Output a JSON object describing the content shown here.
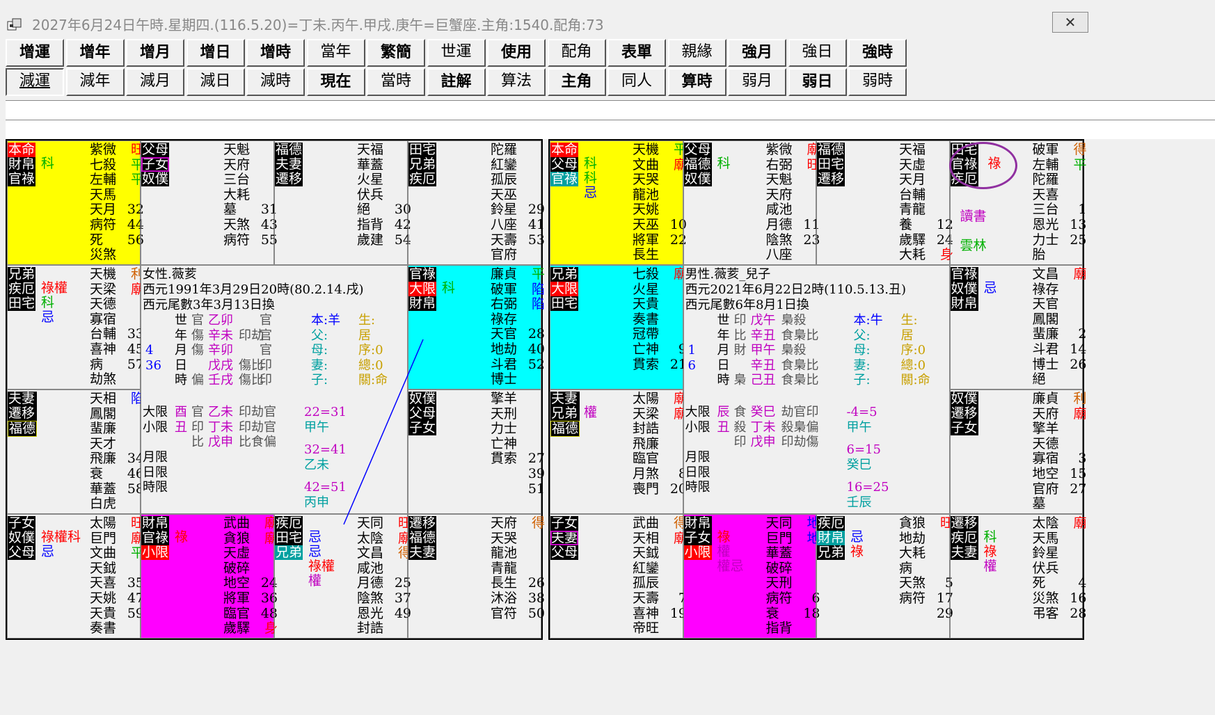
{
  "window": {
    "title": "2027年6月24日午時.星期四.(116.5.20)=丁未.丙午.甲戌.庚午=巨蟹座.主角:1540.配角:73",
    "close": "✕"
  },
  "toolbar": {
    "row1": [
      "增運",
      "增年",
      "增月",
      "增日",
      "增時",
      "當年",
      "繁簡",
      "世運",
      "使用",
      "配角",
      "表單",
      "親緣",
      "強月",
      "強日",
      "強時"
    ],
    "row2": [
      "減運",
      "減年",
      "減月",
      "減日",
      "減時",
      "現在",
      "當時",
      "註解",
      "算法",
      "主角",
      "同人",
      "算時",
      "弱月",
      "弱日",
      "弱時"
    ]
  },
  "left_chart": {
    "c00": {
      "labels": [
        "本命",
        "財帛",
        "官祿"
      ],
      "marks": [
        "科"
      ],
      "stars": [
        [
          "紫微",
          "旺"
        ],
        [
          "七殺",
          "平"
        ],
        [
          "左輔",
          "平"
        ],
        [
          "天馬",
          ""
        ],
        [
          "天月",
          "32"
        ],
        [
          "病符",
          "44"
        ],
        [
          "死",
          "56"
        ],
        [
          "災煞",
          ""
        ]
      ]
    },
    "c01": {
      "labels": [
        "父母",
        "子女",
        "奴僕"
      ],
      "stars": [
        [
          "天魁",
          ""
        ],
        [
          "天府",
          ""
        ],
        [
          "三台",
          ""
        ],
        [
          "大耗",
          ""
        ],
        [
          "墓",
          "31"
        ],
        [
          "天煞",
          "43"
        ],
        [
          "病符",
          "55"
        ]
      ]
    },
    "c02": {
      "labels": [
        "福德",
        "夫妻",
        "遷移"
      ],
      "stars": [
        [
          "天福",
          ""
        ],
        [
          "華蓋",
          ""
        ],
        [
          "火星",
          ""
        ],
        [
          "伏兵",
          ""
        ],
        [
          "絕",
          "30"
        ],
        [
          "指背",
          "42"
        ],
        [
          "歲建",
          "54"
        ]
      ]
    },
    "c03": {
      "labels": [
        "田宅",
        "兄弟",
        "疾厄"
      ],
      "stars": [
        [
          "陀羅",
          ""
        ],
        [
          "紅鑾",
          ""
        ],
        [
          "孤辰",
          ""
        ],
        [
          "天巫",
          ""
        ],
        [
          "鈴星",
          "29"
        ],
        [
          "八座",
          "41"
        ],
        [
          "天壽",
          "53"
        ],
        [
          "官府",
          ""
        ]
      ]
    },
    "c10": {
      "labels": [
        "兄弟",
        "疾厄",
        "田宅"
      ],
      "marks": [
        "祿權",
        "科",
        "忌"
      ],
      "stars": [
        [
          "天機",
          "利"
        ],
        [
          "天梁",
          "廟"
        ],
        [
          "天德",
          ""
        ],
        [
          "寡宿",
          ""
        ],
        [
          "台輔",
          "33"
        ],
        [
          "喜神",
          "45"
        ],
        [
          "病",
          "57"
        ],
        [
          "劫煞",
          ""
        ]
      ]
    },
    "c13": {
      "labels": [
        "官祿",
        "大限",
        "財帛"
      ],
      "marks": [
        "科"
      ],
      "stars": [
        [
          "廉貞",
          "平"
        ],
        [
          "破軍",
          "陷"
        ],
        [
          "右弼",
          "陷"
        ],
        [
          "祿存",
          ""
        ],
        [
          "天官",
          "28"
        ],
        [
          "地劫",
          "40"
        ],
        [
          "斗君",
          "52"
        ],
        [
          "博士",
          ""
        ]
      ]
    },
    "c20": {
      "labels": [
        "夫妻",
        "遷移",
        "福德"
      ],
      "stars": [
        [
          "天相",
          "陷"
        ],
        [
          "鳳閣",
          ""
        ],
        [
          "蜚廉",
          ""
        ],
        [
          "天才",
          ""
        ],
        [
          "飛廉",
          "34"
        ],
        [
          "衰",
          "46"
        ],
        [
          "華蓋",
          "58"
        ],
        [
          "白虎",
          ""
        ]
      ]
    },
    "c23": {
      "labels": [
        "奴僕",
        "父母",
        "子女"
      ],
      "stars": [
        [
          "擎羊",
          ""
        ],
        [
          "天刑",
          ""
        ],
        [
          "力士",
          ""
        ],
        [
          "亡神",
          ""
        ],
        [
          "貫索",
          "27"
        ],
        [
          "",
          "39"
        ],
        [
          "",
          "51"
        ]
      ]
    },
    "c30": {
      "labels": [
        "子女",
        "奴僕",
        "父母"
      ],
      "marks": [
        "祿權科",
        "忌"
      ],
      "stars": [
        [
          "太陽",
          "旺"
        ],
        [
          "巨門",
          "廟"
        ],
        [
          "文曲",
          "平"
        ],
        [
          "天鉞",
          ""
        ],
        [
          "天喜",
          "35"
        ],
        [
          "天姚",
          "47"
        ],
        [
          "天貴",
          "59"
        ],
        [
          "奏書",
          ""
        ]
      ]
    },
    "c31": {
      "labels": [
        "財帛",
        "官祿",
        "小限"
      ],
      "marks": [
        "祿"
      ],
      "stars": [
        [
          "武曲",
          "廟"
        ],
        [
          "貪狼",
          "廟"
        ],
        [
          "天虛",
          ""
        ],
        [
          "破碎",
          ""
        ],
        [
          "地空",
          "24"
        ],
        [
          "將軍",
          "36"
        ],
        [
          "臨官",
          "48"
        ],
        [
          "歲驛",
          "身"
        ]
      ]
    },
    "c32": {
      "labels": [
        "疾厄",
        "田宅",
        "兄弟"
      ],
      "marks": [
        "忌",
        "忌",
        "祿權",
        "權"
      ],
      "stars": [
        [
          "天同",
          "旺"
        ],
        [
          "太陰",
          "廟"
        ],
        [
          "文昌",
          "得"
        ],
        [
          "咸池",
          ""
        ],
        [
          "月德",
          "25"
        ],
        [
          "陰煞",
          "37"
        ],
        [
          "恩光",
          "49"
        ],
        [
          "封誥",
          ""
        ]
      ]
    },
    "c33": {
      "labels": [
        "遷移",
        "福德",
        "夫妻"
      ],
      "stars": [
        [
          "天府",
          "得"
        ],
        [
          "天哭",
          ""
        ],
        [
          "龍池",
          ""
        ],
        [
          "青龍",
          ""
        ],
        [
          "長生",
          "26"
        ],
        [
          "沐浴",
          "38"
        ],
        [
          "官符",
          "50"
        ]
      ]
    },
    "center": {
      "line1": "女性.薇荄",
      "line2": "西元1991年3月29日20時(80.2.14.戌)",
      "line3": "西元尾數3年3月13日換",
      "pillars": [
        [
          "世",
          "官",
          "乙卯",
          "",
          "官"
        ],
        [
          "年",
          "傷",
          "辛未",
          "印劫",
          "官"
        ],
        [
          "月",
          "傷",
          "辛卯",
          "",
          "官"
        ],
        [
          "日",
          "",
          "戊戌",
          "傷比",
          "印"
        ],
        [
          "時",
          "偏",
          "壬戌",
          "傷比",
          "印"
        ]
      ],
      "nums": [
        "4",
        "36"
      ],
      "ben": [
        "本:羊",
        "父:",
        "母:",
        "妻:",
        "子:"
      ],
      "sheng": [
        "生:",
        "居",
        "序:0",
        "總:0",
        "關:命"
      ],
      "dx": [
        "大限",
        "酉",
        "官",
        "乙未",
        "印劫官"
      ],
      "xx": [
        "小限",
        "丑",
        "印",
        "丁未",
        "印劫官"
      ],
      "x3": [
        "",
        "",
        "比",
        "戊申",
        "比食偏"
      ],
      "ranges": [
        "22=31",
        "甲午",
        "32=41",
        "乙未",
        "42=51",
        "丙申"
      ],
      "yue": [
        "月限",
        "日限",
        "時限"
      ]
    }
  },
  "right_chart": {
    "c00": {
      "labels": [
        "本命",
        "父母",
        "官祿"
      ],
      "marks": [
        "科",
        "科",
        "忌"
      ],
      "stars": [
        [
          "天機",
          "平"
        ],
        [
          "文曲",
          "廟"
        ],
        [
          "天哭",
          ""
        ],
        [
          "龍池",
          ""
        ],
        [
          "天姚",
          ""
        ],
        [
          "天巫",
          "10"
        ],
        [
          "將軍",
          "22"
        ],
        [
          "長生",
          ""
        ]
      ]
    },
    "c01": {
      "labels": [
        "父母",
        "福德",
        "奴僕"
      ],
      "marks": [
        "科"
      ],
      "stars": [
        [
          "紫微",
          "廟"
        ],
        [
          "右弼",
          "旺"
        ],
        [
          "天魁",
          ""
        ],
        [
          "天府",
          ""
        ],
        [
          "咸池",
          ""
        ],
        [
          "月德",
          "11"
        ],
        [
          "陰煞",
          "23"
        ],
        [
          "八座",
          ""
        ]
      ]
    },
    "c02": {
      "labels": [
        "福德",
        "田宅",
        "遷移"
      ],
      "stars": [
        [
          "天福",
          ""
        ],
        [
          "天虛",
          ""
        ],
        [
          "天月",
          ""
        ],
        [
          "台輔",
          ""
        ],
        [
          "青龍",
          ""
        ],
        [
          "養",
          "12"
        ],
        [
          "歲驛",
          "24"
        ],
        [
          "大耗",
          "身"
        ]
      ]
    },
    "c03": {
      "labels": [
        "田宅",
        "官祿",
        "疾厄"
      ],
      "marks": [
        "祿",
        "讀書",
        "雲林"
      ],
      "stars": [
        [
          "破軍",
          "得"
        ],
        [
          "左輔",
          "平"
        ],
        [
          "陀羅",
          ""
        ],
        [
          "天喜",
          ""
        ],
        [
          "三台",
          "1"
        ],
        [
          "恩光",
          "13"
        ],
        [
          "力士",
          "25"
        ],
        [
          "胎",
          ""
        ]
      ]
    },
    "c10": {
      "labels": [
        "兄弟",
        "大限",
        "田宅"
      ],
      "stars": [
        [
          "七殺",
          "廟"
        ],
        [
          "火星",
          ""
        ],
        [
          "天貴",
          ""
        ],
        [
          "奏書",
          ""
        ],
        [
          "冠帶",
          ""
        ],
        [
          "亡神",
          "9"
        ],
        [
          "貫索",
          "21"
        ]
      ]
    },
    "c13": {
      "labels": [
        "官祿",
        "奴僕",
        "財帛"
      ],
      "marks": [
        "忌"
      ],
      "stars": [
        [
          "文昌",
          "廟"
        ],
        [
          "祿存",
          ""
        ],
        [
          "天官",
          ""
        ],
        [
          "鳳閣",
          ""
        ],
        [
          "蜚廉",
          "2"
        ],
        [
          "斗君",
          "14"
        ],
        [
          "博士",
          "26"
        ],
        [
          "絕",
          ""
        ]
      ]
    },
    "c20": {
      "labels": [
        "夫妻",
        "兄弟",
        "福德"
      ],
      "marks": [
        "權"
      ],
      "stars": [
        [
          "太陽",
          "廟"
        ],
        [
          "天梁",
          "廟"
        ],
        [
          "封誥",
          ""
        ],
        [
          "飛廉",
          ""
        ],
        [
          "臨官",
          ""
        ],
        [
          "月煞",
          "8"
        ],
        [
          "喪門",
          "20"
        ]
      ]
    },
    "c23": {
      "labels": [
        "奴僕",
        "遷移",
        "子女"
      ],
      "stars": [
        [
          "廉貞",
          "利"
        ],
        [
          "天府",
          "廟"
        ],
        [
          "擎羊",
          ""
        ],
        [
          "天德",
          ""
        ],
        [
          "寡宿",
          "3"
        ],
        [
          "地空",
          "15"
        ],
        [
          "官府",
          "27"
        ],
        [
          "墓",
          ""
        ]
      ]
    },
    "c30": {
      "labels": [
        "子女",
        "夫妻",
        "父母"
      ],
      "stars": [
        [
          "武曲",
          "得"
        ],
        [
          "天相",
          "廟"
        ],
        [
          "天鉞",
          ""
        ],
        [
          "紅鑾",
          ""
        ],
        [
          "孤辰",
          ""
        ],
        [
          "天壽",
          "7"
        ],
        [
          "喜神",
          "19"
        ],
        [
          "帝旺",
          ""
        ]
      ]
    },
    "c31": {
      "labels": [
        "財帛",
        "子女",
        "小限"
      ],
      "marks": [
        "祿",
        "權",
        "權忌"
      ],
      "stars": [
        [
          "天同",
          "地"
        ],
        [
          "巨門",
          "地"
        ],
        [
          "華蓋",
          ""
        ],
        [
          "破碎",
          ""
        ],
        [
          "天刑",
          ""
        ],
        [
          "病符",
          "6"
        ],
        [
          "衰",
          "18"
        ],
        [
          "指背",
          ""
        ]
      ]
    },
    "c32": {
      "labels": [
        "疾厄",
        "財帛",
        "兄弟"
      ],
      "marks": [
        "忌",
        "祿"
      ],
      "stars": [
        [
          "貪狼",
          "旺"
        ],
        [
          "地劫",
          ""
        ],
        [
          "大耗",
          ""
        ],
        [
          "病",
          ""
        ],
        [
          "天煞",
          "5"
        ],
        [
          "病符",
          "17"
        ],
        [
          "",
          "29"
        ]
      ]
    },
    "c33": {
      "labels": [
        "遷移",
        "疾厄",
        "夫妻"
      ],
      "marks": [
        "科",
        "祿",
        "權"
      ],
      "stars": [
        [
          "太陰",
          "廟"
        ],
        [
          "天馬",
          ""
        ],
        [
          "鈴星",
          ""
        ],
        [
          "伏兵",
          ""
        ],
        [
          "死",
          "4"
        ],
        [
          "災煞",
          "16"
        ],
        [
          "弔客",
          "28"
        ]
      ]
    },
    "center": {
      "line1": "男性.薇荄_兒子",
      "line2": "西元2021年6月22日2時(110.5.13.丑)",
      "line3": "西元尾數6年8月1日換",
      "pillars": [
        [
          "世",
          "印",
          "戊午",
          "梟殺",
          ""
        ],
        [
          "年",
          "比",
          "辛丑",
          "食梟比",
          ""
        ],
        [
          "月",
          "財",
          "甲午",
          "梟殺",
          ""
        ],
        [
          "日",
          "",
          "辛丑",
          "食梟比",
          ""
        ],
        [
          "時",
          "梟",
          "己丑",
          "食梟比",
          ""
        ]
      ],
      "nums": [
        "1",
        "6"
      ],
      "ben": [
        "本:牛",
        "父:",
        "母:",
        "妻:",
        "子:"
      ],
      "sheng": [
        "生:",
        "居",
        "序:0",
        "總:0",
        "關:命"
      ],
      "dx": [
        "大限",
        "辰",
        "食",
        "癸巳",
        "劫官印"
      ],
      "xx": [
        "小限",
        "丑",
        "殺",
        "丁未",
        "殺梟偏"
      ],
      "x3": [
        "",
        "",
        "印",
        "戊申",
        "印劫傷"
      ],
      "ranges": [
        "-4=5",
        "甲午",
        "6=15",
        "癸巳",
        "16=25",
        "壬辰"
      ],
      "yue": [
        "月限",
        "日限",
        "時限"
      ]
    }
  }
}
